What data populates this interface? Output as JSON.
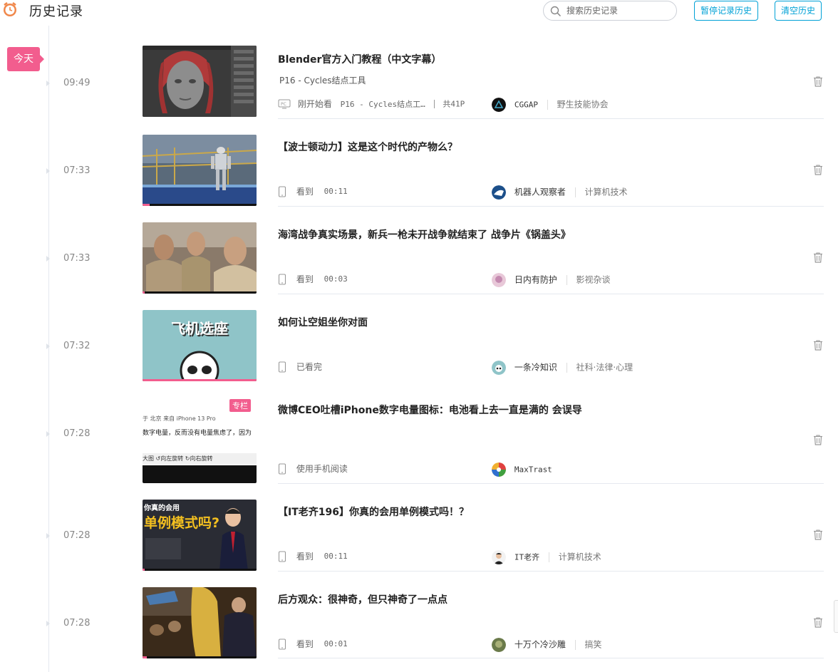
{
  "header": {
    "title": "历史记录",
    "search_placeholder": "搜索历史记录",
    "pause_label": "暂停记录历史",
    "clear_label": "清空历史"
  },
  "day_label": "今天",
  "colors": {
    "accent": "#00a1d6",
    "pink": "#f25d8e"
  },
  "items": [
    {
      "time": "09:49",
      "title": "Blender官方入门教程（中文字幕）",
      "subtitle": "P16 - Cycles结点工具",
      "device_icon": "pc-icon",
      "status": "刚开始看",
      "part": "P16 - Cycles结点工…",
      "total": "共41P",
      "uploader": "CGGAP",
      "category": "野生技能协会",
      "progress": 0
    },
    {
      "time": "07:33",
      "title": "【波士顿动力】这是这个时代的产物么？",
      "device_icon": "phone-icon",
      "status": "看到",
      "watched": "00:11",
      "uploader": "机器人观察者",
      "category": "计算机技术",
      "progress": 0.06
    },
    {
      "time": "07:33",
      "title": "海湾战争真实场景，新兵一枪未开战争就结束了 战争片《锅盖头》",
      "device_icon": "phone-icon",
      "status": "看到",
      "watched": "00:03",
      "uploader": "日内有防护",
      "category": "影视杂谈",
      "progress": 0.02
    },
    {
      "time": "07:32",
      "title": "如何让空姐坐你对面",
      "thumb_text": "飞机选座",
      "device_icon": "phone-icon",
      "status": "已看完",
      "uploader": "一条冷知识",
      "category": "社科·法律·心理",
      "progress": 1
    },
    {
      "time": "07:28",
      "title": "微博CEO吐槽iPhone数字电量图标：电池看上去一直是满的 会误导",
      "badge": "专栏",
      "thumb_lines": [
        "于 北京 来自 iPhone 13 Pro",
        "数字电量，反而没有电量焦虑了，因为",
        "大图  ↺向左旋转  ↻向右旋转"
      ],
      "device_icon": "phone-icon",
      "status": "使用手机阅读",
      "uploader": "MaxTrast",
      "category": ""
    },
    {
      "time": "07:28",
      "title": "【IT老齐196】你真的会用单例模式吗！？",
      "thumb_text_top": "你真的会用",
      "thumb_text_big": "单例模式吗?",
      "device_icon": "phone-icon",
      "status": "看到",
      "watched": "00:11",
      "uploader": "IT老齐",
      "category": "计算机技术",
      "progress": 0.02
    },
    {
      "time": "07:28",
      "title": "后方观众：很神奇，但只神奇了一点点",
      "device_icon": "phone-icon",
      "status": "看到",
      "watched": "00:01",
      "uploader": "十万个冷沙雕",
      "category": "搞笑",
      "progress": 0.04
    }
  ]
}
